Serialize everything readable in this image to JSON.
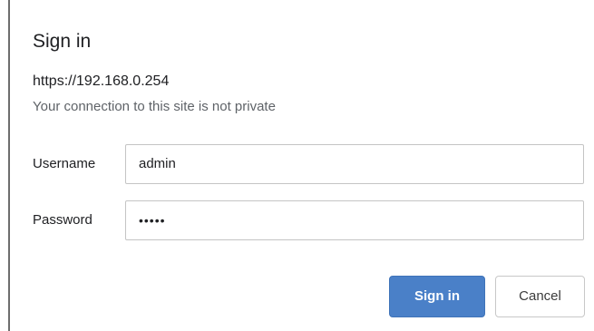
{
  "dialog": {
    "title": "Sign in",
    "url": "https://192.168.0.254",
    "warning": "Your connection to this site is not private"
  },
  "form": {
    "username_label": "Username",
    "username_value": "admin",
    "password_label": "Password",
    "password_display": "•••••"
  },
  "buttons": {
    "sign_in_label": "Sign in",
    "cancel_label": "Cancel"
  },
  "colors": {
    "primary_button": "#4a80c8",
    "text": "#202124",
    "secondary_text": "#5f6368"
  }
}
